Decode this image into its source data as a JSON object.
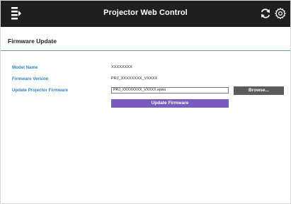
{
  "header": {
    "app_title": "Projector Web Control",
    "icons": {
      "menu": "menu-icon",
      "refresh": "refresh-icon",
      "settings": "gear-icon"
    }
  },
  "page": {
    "title": "Firmware Update"
  },
  "fields": {
    "model_name": {
      "label": "Model Name",
      "value": "XXXXXXXX"
    },
    "firmware_version": {
      "label": "Firmware Version",
      "value": "PRJ_XXXXXXXX_VXXXX"
    },
    "update_firmware": {
      "label": "Update Projector Firmware",
      "file_value": "PRJ_XXXXXXXX_VXXXX.epwu"
    }
  },
  "buttons": {
    "browse": "Browse...",
    "update": "Update Firmware"
  },
  "colors": {
    "topbar": "#1f1f1f",
    "label": "#2f86c1",
    "accent_line": "#4aa3c7",
    "browse": "#5b5b5b",
    "update": "#7a5cc0"
  }
}
